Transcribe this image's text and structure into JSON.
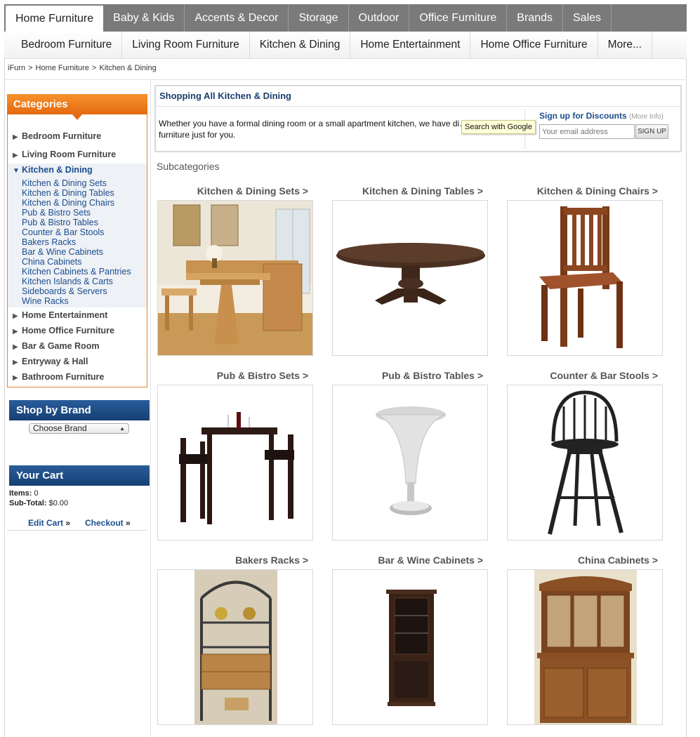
{
  "nav": {
    "primary": [
      "Home Furniture",
      "Baby & Kids",
      "Accents & Decor",
      "Storage",
      "Outdoor",
      "Office Furniture",
      "Brands",
      "Sales"
    ],
    "secondary": [
      "Bedroom Furniture",
      "Living Room Furniture",
      "Kitchen & Dining",
      "Home Entertainment",
      "Home Office Furniture",
      "More..."
    ]
  },
  "breadcrumb": [
    "iFurn",
    "Home Furniture",
    "Kitchen & Dining"
  ],
  "breadcrumb_sep": ">",
  "sidebar": {
    "categories_title": "Categories",
    "top_items": [
      "Bedroom Furniture",
      "Living Room Furniture"
    ],
    "active_item": "Kitchen & Dining",
    "subitems": [
      "Kitchen & Dining Sets",
      "Kitchen & Dining Tables",
      "Kitchen & Dining Chairs",
      "Pub & Bistro Sets",
      "Pub & Bistro Tables",
      "Counter & Bar Stools",
      "Bakers Racks",
      "Bar & Wine Cabinets",
      "China Cabinets",
      "Kitchen Cabinets & Pantries",
      "Kitchen Islands & Carts",
      "Sideboards & Servers",
      "Wine Racks"
    ],
    "bottom_items": [
      "Home Entertainment",
      "Home Office Furniture",
      "Bar & Game Room",
      "Entryway & Hall",
      "Bathroom Furniture"
    ],
    "brand_title": "Shop by Brand",
    "brand_select": "Choose Brand",
    "cart_title": "Your Cart",
    "cart_items_label": "Items:",
    "cart_items_value": "0",
    "cart_subtotal_label": "Sub-Total:",
    "cart_subtotal_value": "$0.00",
    "edit_cart": "Edit Cart",
    "checkout": "Checkout",
    "link_suffix": "»"
  },
  "shop": {
    "title": "Shopping All Kitchen & Dining",
    "description": "Whether you have a formal dining room or a small apartment kitchen, we have di... kitchen furniture just for you.",
    "tooltip": "Search with Google",
    "signup_title": "Sign up for Discounts",
    "signup_more": "(More Info)",
    "email_placeholder": "Your email address",
    "signup_button": "SIGN UP"
  },
  "subcategories_label": "Subcategories",
  "cards": [
    {
      "title": "Kitchen & Dining Sets >",
      "icon": "dining-set-image"
    },
    {
      "title": "Kitchen & Dining Tables >",
      "icon": "dining-table-image"
    },
    {
      "title": "Kitchen & Dining Chairs >",
      "icon": "dining-chair-image"
    },
    {
      "title": "Pub & Bistro Sets >",
      "icon": "pub-set-image"
    },
    {
      "title": "Pub & Bistro Tables >",
      "icon": "bistro-table-image"
    },
    {
      "title": "Counter & Bar Stools >",
      "icon": "bar-stool-image"
    },
    {
      "title": "Bakers Racks >",
      "icon": "bakers-rack-image"
    },
    {
      "title": "Bar & Wine Cabinets >",
      "icon": "wine-cabinet-image"
    },
    {
      "title": "China Cabinets >",
      "icon": "china-cabinet-image"
    }
  ]
}
